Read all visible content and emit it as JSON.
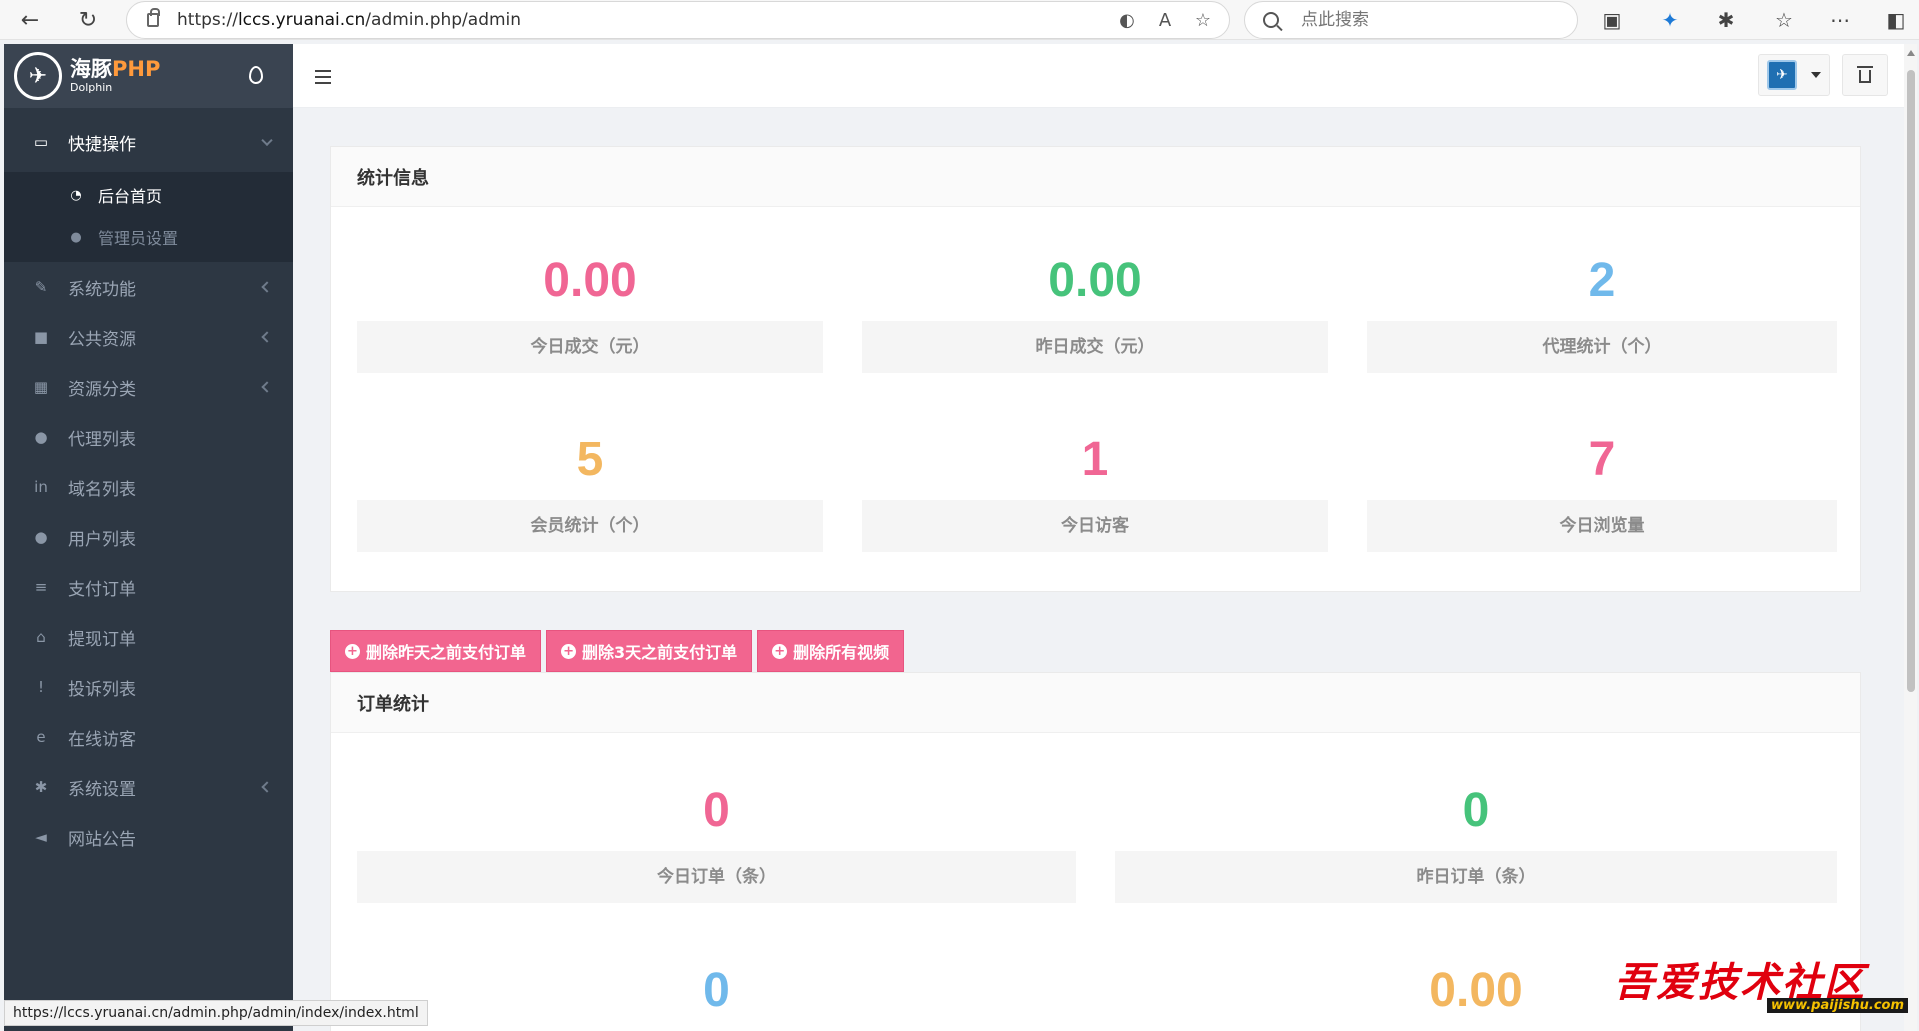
{
  "browser": {
    "url_prefix": "https://",
    "url_domain": "lccs.yruanai.cn",
    "url_path": "/admin.php/admin",
    "search_placeholder": "点此搜索"
  },
  "brand": {
    "name_cn": "海豚",
    "name_php": "PHP",
    "name_en": "Dolphin"
  },
  "sidebar": {
    "group": {
      "label": "快捷操作",
      "icon": "folder-open-icon",
      "items": [
        {
          "label": "后台首页",
          "icon": "dashboard-icon"
        },
        {
          "label": "管理员设置",
          "icon": "user-icon"
        }
      ]
    },
    "items": [
      {
        "label": "系统功能",
        "icon": "wrench-icon"
      },
      {
        "label": "公共资源",
        "icon": "video-camera-icon"
      },
      {
        "label": "资源分类",
        "icon": "grid-icon"
      },
      {
        "label": "代理列表",
        "icon": "users-icon"
      },
      {
        "label": "域名列表",
        "icon": "linkedin-icon"
      },
      {
        "label": "用户列表",
        "icon": "user-icon"
      },
      {
        "label": "支付订单",
        "icon": "database-icon"
      },
      {
        "label": "提现订单",
        "icon": "bank-icon"
      },
      {
        "label": "投诉列表",
        "icon": "exclamation-circle-icon"
      },
      {
        "label": "在线访客",
        "icon": "ie-icon"
      },
      {
        "label": "系统设置",
        "icon": "cog-icon"
      },
      {
        "label": "网站公告",
        "icon": "bullhorn-icon"
      }
    ]
  },
  "stats_panel": {
    "title": "统计信息",
    "stats": [
      {
        "value": "0.00",
        "label": "今日成交（元）",
        "color": "#f06694"
      },
      {
        "value": "0.00",
        "label": "昨日成交（元）",
        "color": "#46c37b"
      },
      {
        "value": "2",
        "label": "代理统计（个）",
        "color": "#70b9eb"
      },
      {
        "value": "5",
        "label": "会员统计（个）",
        "color": "#f3b760"
      },
      {
        "value": "1",
        "label": "今日访客",
        "color": "#f06694"
      },
      {
        "value": "7",
        "label": "今日浏览量",
        "color": "#f06694"
      }
    ]
  },
  "action_buttons": [
    {
      "label": "删除昨天之前支付订单"
    },
    {
      "label": "删除3天之前支付订单"
    },
    {
      "label": "删除所有视频"
    }
  ],
  "orders_panel": {
    "title": "订单统计",
    "stats": [
      {
        "value": "0",
        "label": "今日订单（条）",
        "color": "#f06694"
      },
      {
        "value": "0",
        "label": "昨日订单（条）",
        "color": "#46c37b"
      },
      {
        "value": "0",
        "label": "",
        "color": "#70b9eb"
      },
      {
        "value": "0.00",
        "label": "",
        "color": "#f3b760"
      }
    ]
  },
  "status_bar": {
    "url": "https://lccs.yruanai.cn/admin.php/admin/index/index.html"
  },
  "watermark": {
    "main": "吾爱技术社区",
    "sub": "www.paijishu.com"
  }
}
